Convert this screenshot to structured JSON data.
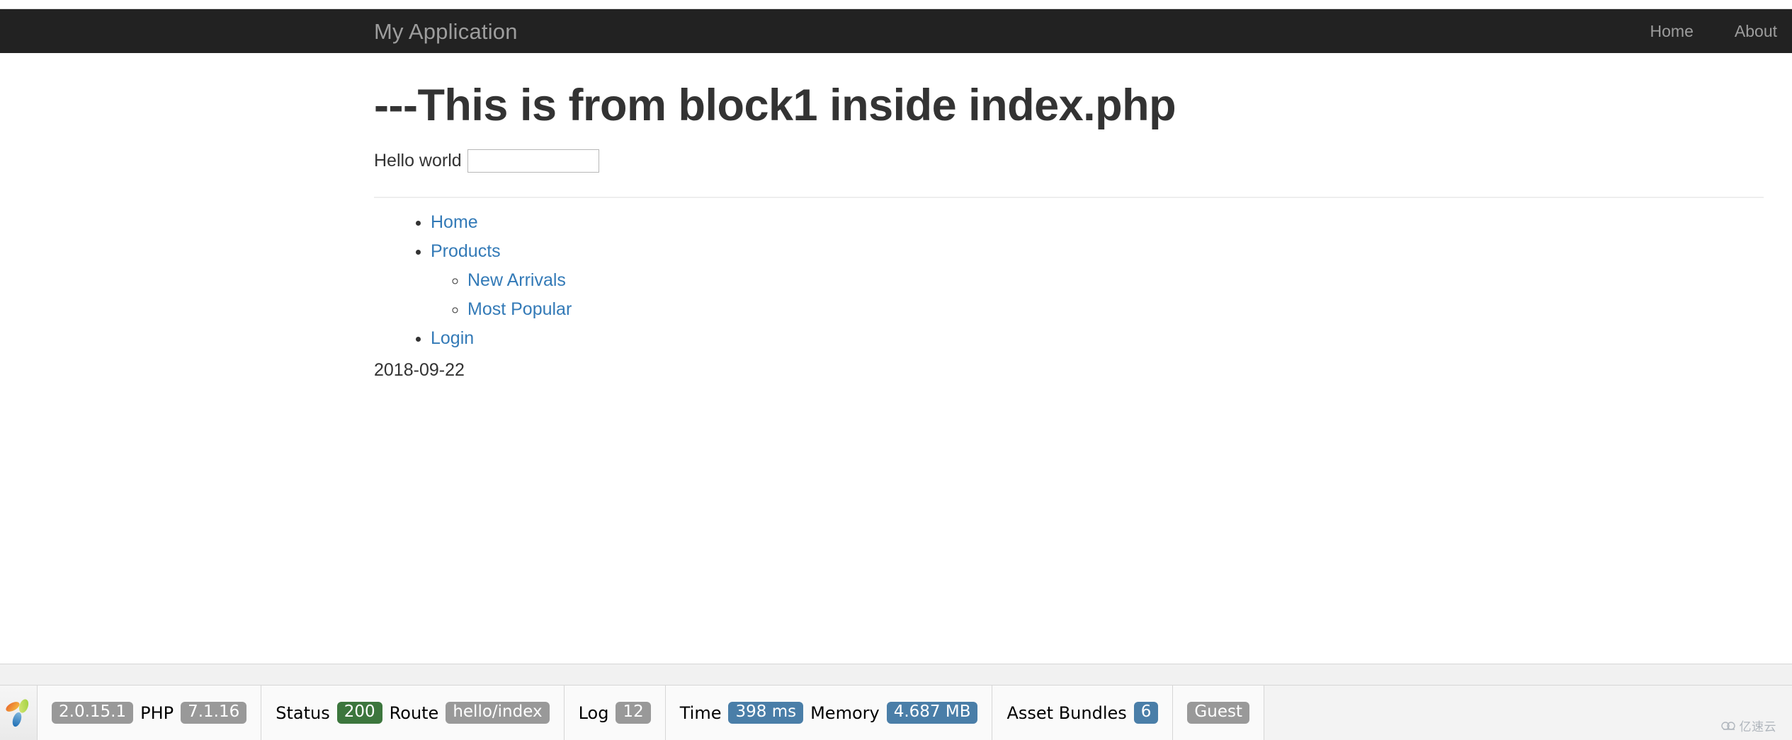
{
  "navbar": {
    "brand": "My Application",
    "links": [
      {
        "label": "Home"
      },
      {
        "label": "About"
      }
    ]
  },
  "main": {
    "heading": "---This is from block1 inside index.php",
    "hello": {
      "label": "Hello world",
      "value": "",
      "placeholder": ""
    },
    "nav_list": [
      {
        "label": "Home",
        "children": []
      },
      {
        "label": "Products",
        "children": [
          {
            "label": "New Arrivals"
          },
          {
            "label": "Most Popular"
          }
        ]
      },
      {
        "label": "Login",
        "children": []
      }
    ],
    "date": "2018-09-22"
  },
  "debug_toolbar": {
    "logo_alt": "yii-logo",
    "blocks": [
      {
        "name": "version",
        "items": [
          {
            "type": "badge",
            "text": "2.0.15.1",
            "color": "#999999"
          },
          {
            "type": "text",
            "text": "PHP"
          },
          {
            "type": "badge",
            "text": "7.1.16",
            "color": "#999999"
          }
        ]
      },
      {
        "name": "request",
        "items": [
          {
            "type": "text",
            "text": "Status"
          },
          {
            "type": "badge",
            "text": "200",
            "color": "#3c763d"
          },
          {
            "type": "text",
            "text": "Route"
          },
          {
            "type": "badge",
            "text": "hello/index",
            "color": "#999999"
          }
        ]
      },
      {
        "name": "log",
        "items": [
          {
            "type": "text",
            "text": "Log"
          },
          {
            "type": "badge",
            "text": "12",
            "color": "#999999"
          }
        ]
      },
      {
        "name": "profiling",
        "items": [
          {
            "type": "text",
            "text": "Time"
          },
          {
            "type": "badge",
            "text": "398 ms",
            "color": "#4a7ea8"
          },
          {
            "type": "text",
            "text": "Memory"
          },
          {
            "type": "badge",
            "text": "4.687 MB",
            "color": "#4a7ea8"
          }
        ]
      },
      {
        "name": "assets",
        "items": [
          {
            "type": "text",
            "text": "Asset Bundles"
          },
          {
            "type": "badge",
            "text": "6",
            "color": "#4a7ea8"
          }
        ]
      },
      {
        "name": "user",
        "items": [
          {
            "type": "badge",
            "text": "Guest",
            "color": "#999999"
          }
        ]
      }
    ],
    "watermark": "亿速云"
  },
  "colors": {
    "navbar_bg": "#222222",
    "navbar_text": "#9d9d9d",
    "link": "#337ab7",
    "heading": "#333333",
    "badge_gray": "#999999",
    "badge_green": "#3c763d",
    "badge_blue": "#4a7ea8",
    "toolbar_bg": "#fafafa"
  }
}
